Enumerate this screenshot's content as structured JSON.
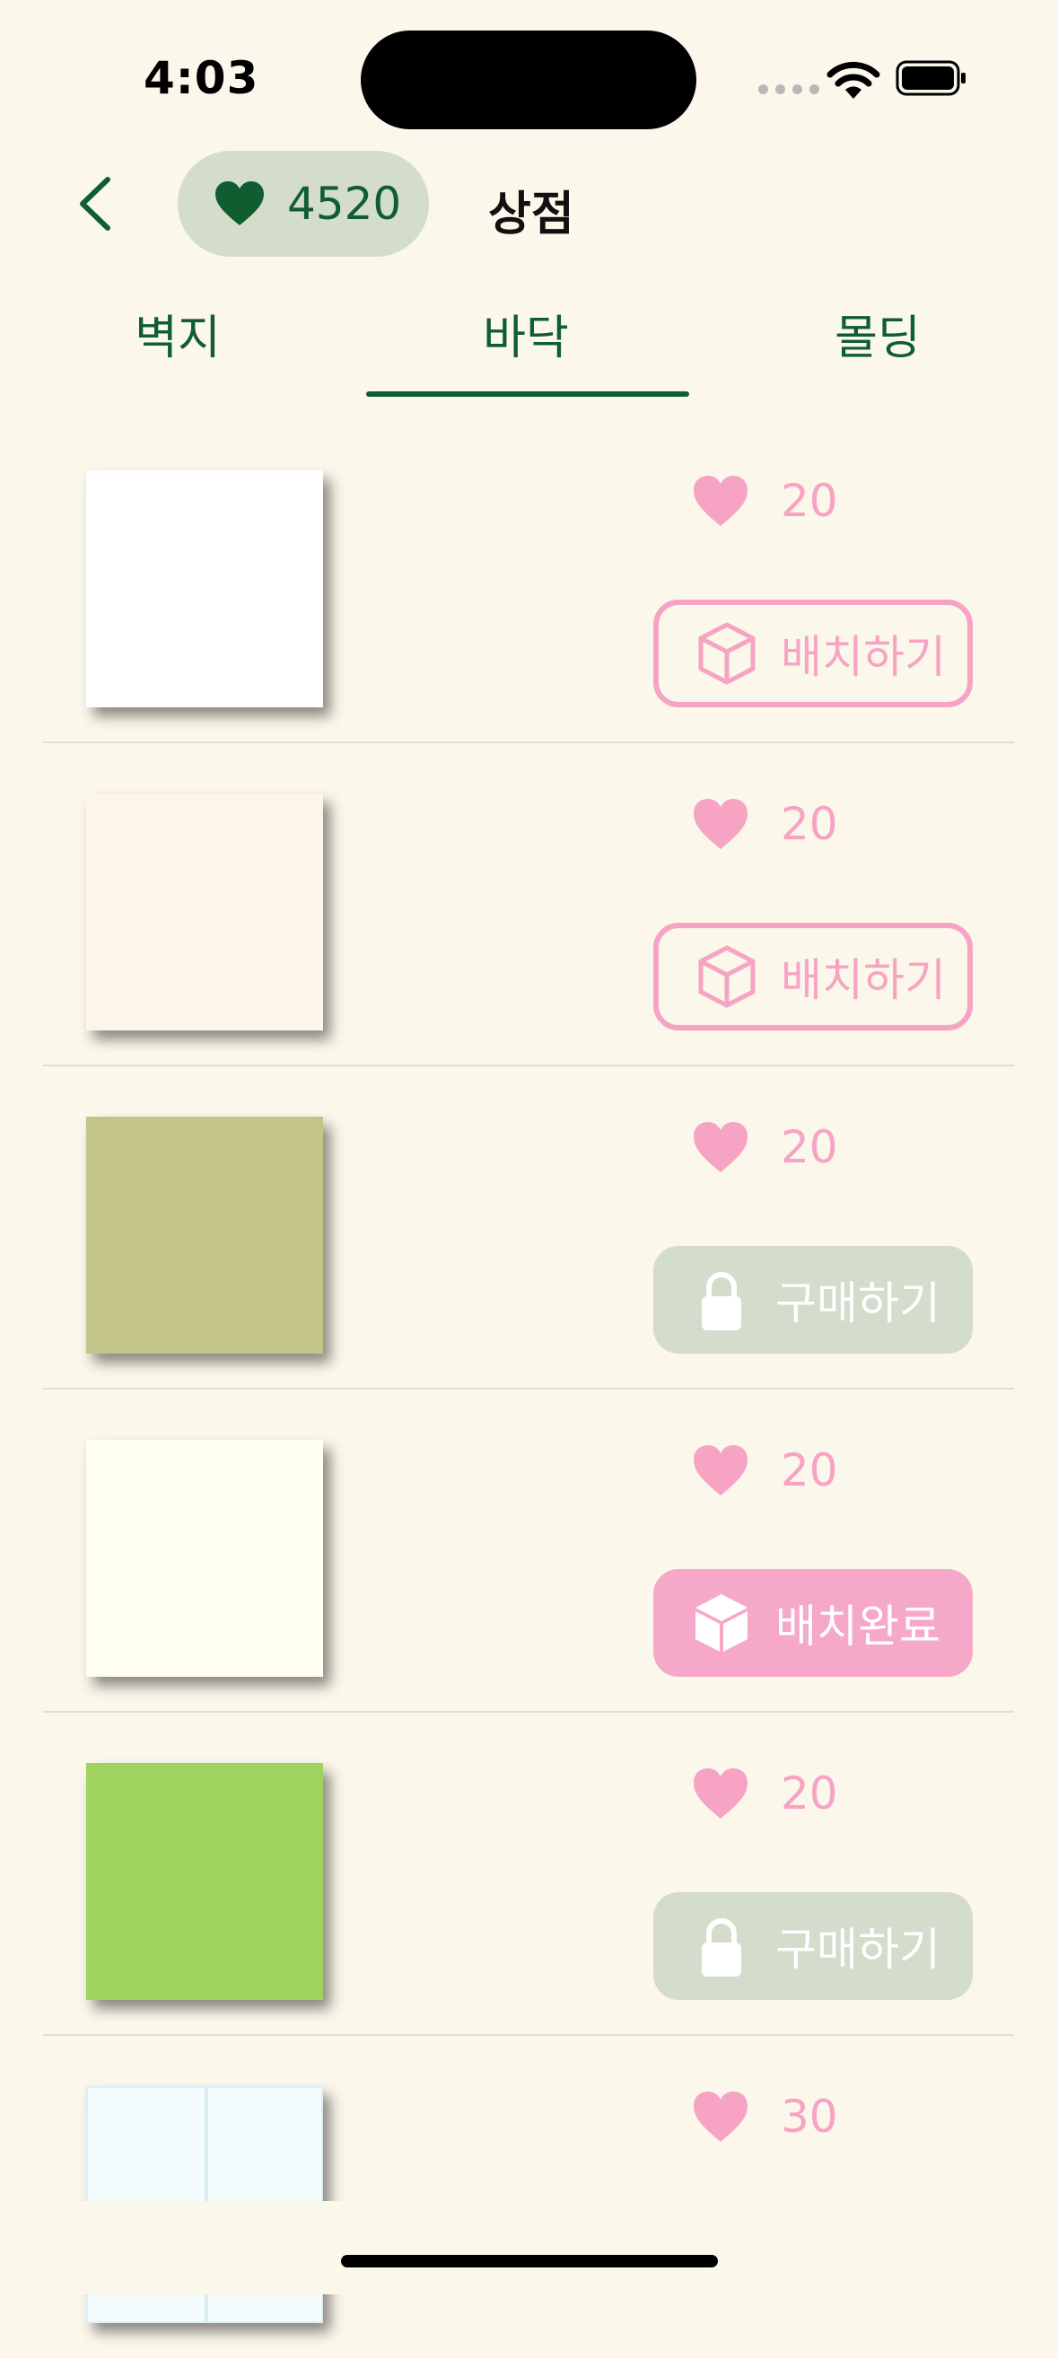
{
  "status_bar": {
    "time": "4:03"
  },
  "header": {
    "heart_count": "4520",
    "title": "상점"
  },
  "tabs": [
    {
      "label": "벽지"
    },
    {
      "label": "바닥",
      "selected": true
    },
    {
      "label": "몰딩"
    }
  ],
  "colors": {
    "green": "#0E5E30",
    "pink": "#F6A3C4",
    "sage": "#D4DCCB",
    "background": "#FBF7EA"
  },
  "items": [
    {
      "swatch_color": "#FFFFFF",
      "price": "20",
      "button_label": "배치하기",
      "button_state": "place",
      "icon": "cube-outline-icon"
    },
    {
      "swatch_color": "#FDF4EA",
      "price": "20",
      "button_label": "배치하기",
      "button_state": "place",
      "icon": "cube-outline-icon"
    },
    {
      "swatch_color": "#C2C48A",
      "price": "20",
      "button_label": "구매하기",
      "button_state": "locked",
      "icon": "lock-icon"
    },
    {
      "swatch_color": "#FFFFF0",
      "price": "20",
      "button_label": "배치완료",
      "button_state": "placed",
      "icon": "cube-filled-icon"
    },
    {
      "swatch_color": "#9DD35E",
      "price": "20",
      "button_label": "구매하기",
      "button_state": "locked",
      "icon": "lock-icon"
    },
    {
      "swatch_color": "#F4FBFD",
      "price": "30"
    }
  ]
}
